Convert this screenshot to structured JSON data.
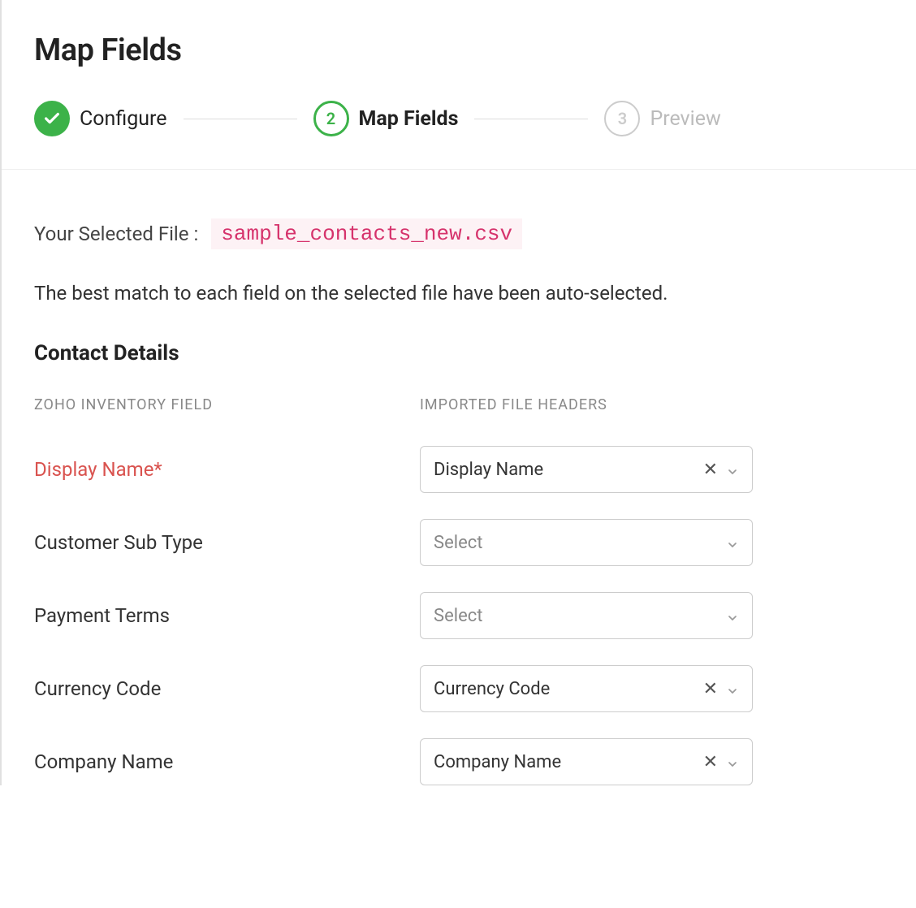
{
  "page_title": "Map Fields",
  "stepper": {
    "step1": {
      "label": "Configure",
      "state": "completed"
    },
    "step2": {
      "number": "2",
      "label": "Map Fields",
      "state": "active"
    },
    "step3": {
      "number": "3",
      "label": "Preview",
      "state": "inactive"
    }
  },
  "selected_file": {
    "label": "Your Selected File :",
    "filename": "sample_contacts_new.csv"
  },
  "description": "The best match to each field on the selected file have been auto-selected.",
  "section_title": "Contact Details",
  "column_headers": {
    "left": "ZOHO INVENTORY FIELD",
    "right": "IMPORTED FILE HEADERS"
  },
  "placeholder": "Select",
  "fields": [
    {
      "label": "Display Name*",
      "required": true,
      "value": "Display Name",
      "has_value": true
    },
    {
      "label": "Customer Sub Type",
      "required": false,
      "value": "",
      "has_value": false
    },
    {
      "label": "Payment Terms",
      "required": false,
      "value": "",
      "has_value": false
    },
    {
      "label": "Currency Code",
      "required": false,
      "value": "Currency Code",
      "has_value": true
    },
    {
      "label": "Company Name",
      "required": false,
      "value": "Company Name",
      "has_value": true
    }
  ]
}
